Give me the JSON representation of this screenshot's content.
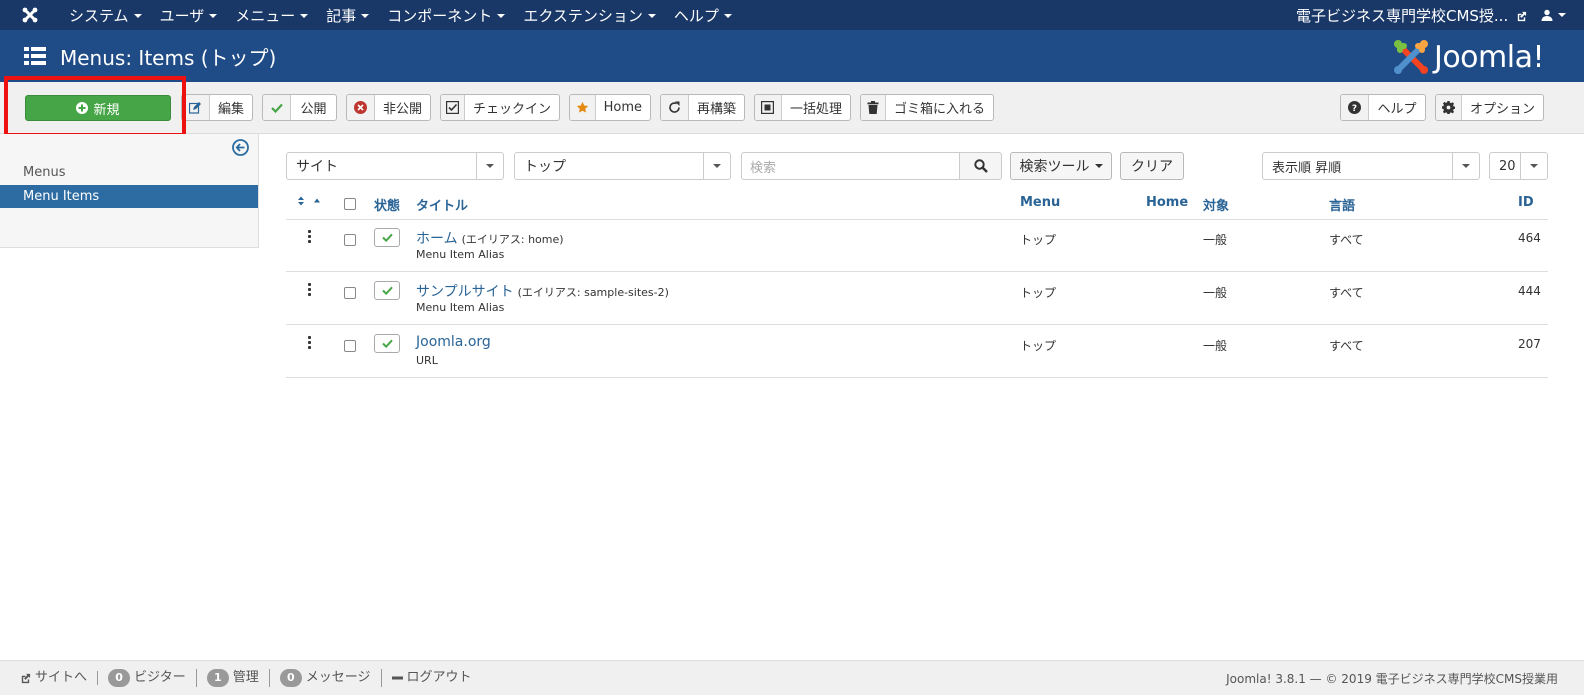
{
  "topnav": {
    "menu": [
      {
        "label": "システム"
      },
      {
        "label": "ユーザ"
      },
      {
        "label": "メニュー"
      },
      {
        "label": "記事"
      },
      {
        "label": "コンポーネント"
      },
      {
        "label": "エクステンション"
      },
      {
        "label": "ヘルプ"
      }
    ],
    "site_name": "電子ビジネス専門学校CMS授..."
  },
  "header": {
    "title": "Menus: Items (トップ)",
    "brand": "Joomla!"
  },
  "toolbar": {
    "new_label": "新規",
    "edit_label": "編集",
    "publish_label": "公開",
    "unpublish_label": "非公開",
    "checkin_label": "チェックイン",
    "home_label": "Home",
    "rebuild_label": "再構築",
    "batch_label": "一括処理",
    "trash_label": "ゴミ箱に入れる",
    "help_label": "ヘルプ",
    "options_label": "オプション",
    "colors": {
      "new_button": "#46a546",
      "highlight": "#ee1111"
    }
  },
  "sidebar": {
    "items": [
      {
        "label": "Menus",
        "active": false
      },
      {
        "label": "Menu Items",
        "active": true
      }
    ]
  },
  "filters": {
    "client_select": "サイト",
    "menu_select": "トップ",
    "search_placeholder": "検索",
    "search_tools_label": "検索ツール",
    "clear_label": "クリア",
    "ordering_select": "表示順 昇順",
    "limit_select": "20"
  },
  "table": {
    "headers": {
      "status": "状態",
      "title": "タイトル",
      "menu": "Menu",
      "home": "Home",
      "access": "対象",
      "language": "言語",
      "id": "ID"
    },
    "rows": [
      {
        "title": "ホーム",
        "alias": "(エイリアス: home)",
        "type": "Menu Item Alias",
        "menu": "トップ",
        "access": "一般",
        "language": "すべて",
        "id": "464"
      },
      {
        "title": "サンプルサイト",
        "alias": "(エイリアス: sample-sites-2)",
        "type": "Menu Item Alias",
        "menu": "トップ",
        "access": "一般",
        "language": "すべて",
        "id": "444"
      },
      {
        "title": "Joomla.org",
        "alias": "",
        "type": "URL",
        "menu": "トップ",
        "access": "一般",
        "language": "すべて",
        "id": "207"
      }
    ]
  },
  "footer": {
    "view_site": "サイトへ",
    "visitors_count": "0",
    "visitors_label": "ビジター",
    "admins_count": "1",
    "admins_label": "管理",
    "messages_count": "0",
    "messages_label": "メッセージ",
    "logout_label": "ログアウト",
    "copyright": "Joomla! 3.8.1 — © 2019 電子ビジネス専門学校CMS授業用"
  }
}
